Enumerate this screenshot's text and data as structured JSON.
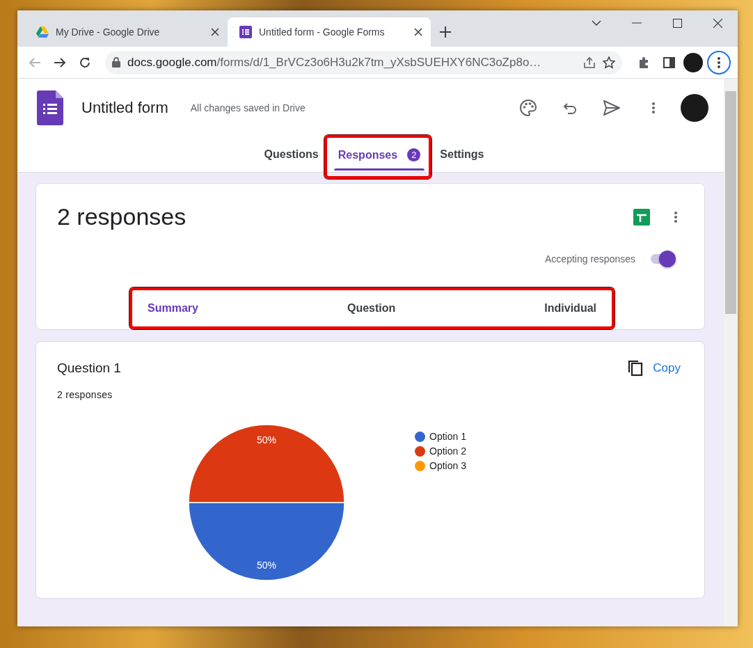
{
  "browser": {
    "tabs": [
      {
        "title": "My Drive - Google Drive",
        "kind": "drive",
        "selected": false
      },
      {
        "title": "Untitled form - Google Forms",
        "kind": "forms",
        "selected": true
      }
    ],
    "address_host": "docs.google.com",
    "address_path": "/forms/d/1_BrVCz3o6H3u2k7tm_yXsbSUEHXY6NC3oZp8o…"
  },
  "form": {
    "title": "Untitled form",
    "save_status": "All changes saved in Drive",
    "tabs": [
      {
        "label": "Questions",
        "selected": false,
        "highlighted": false
      },
      {
        "label": "Responses",
        "badge": "2",
        "selected": true,
        "highlighted": true
      },
      {
        "label": "Settings",
        "selected": false,
        "highlighted": false
      }
    ]
  },
  "responses_card": {
    "heading": "2 responses",
    "accepting_label": "Accepting responses",
    "accepting_on": true,
    "view_tabs_highlighted": true,
    "view_tabs": [
      {
        "label": "Summary",
        "selected": true
      },
      {
        "label": "Question",
        "selected": false
      },
      {
        "label": "Individual",
        "selected": false
      }
    ]
  },
  "question_card": {
    "title": "Question 1",
    "count": "2 responses",
    "copy_label": "Copy",
    "chart_data": {
      "type": "pie",
      "categories": [
        "Option 1",
        "Option 2",
        "Option 3"
      ],
      "value_labels": [
        "50%",
        "50%",
        null
      ],
      "series": [
        {
          "colors": [
            "#3366cc",
            "#dc3912",
            "#ff9900"
          ],
          "values": [
            50,
            50,
            0
          ]
        }
      ]
    }
  }
}
